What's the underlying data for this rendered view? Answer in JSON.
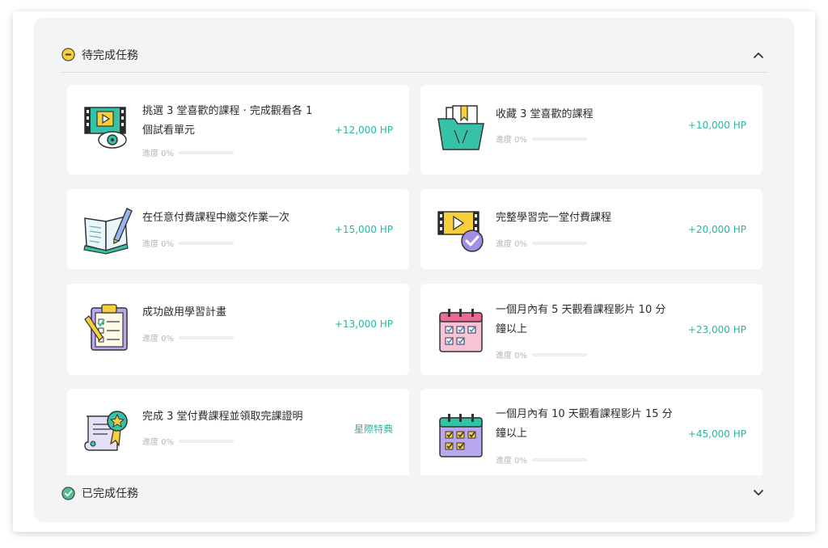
{
  "pending": {
    "title": "待完成任務",
    "tasks": [
      {
        "title": "挑選 3 堂喜歡的課程 · 完成觀看各 1 個試看單元",
        "progress_label": "進度 0%",
        "progress": 0,
        "reward": "+12,000 HP",
        "icon": "film-eye-icon"
      },
      {
        "title": "收藏 3 堂喜歡的課程",
        "progress_label": "進度 0%",
        "progress": 0,
        "reward": "+10,000 HP",
        "icon": "folder-bookmark-icon"
      },
      {
        "title": "在任意付費課程中繳交作業一次",
        "progress_label": "進度 0%",
        "progress": 0,
        "reward": "+15,000 HP",
        "icon": "notebook-pencil-icon"
      },
      {
        "title": "完整學習完一堂付費課程",
        "progress_label": "進度 0%",
        "progress": 0,
        "reward": "+20,000 HP",
        "icon": "film-check-icon"
      },
      {
        "title": "成功啟用學習計畫",
        "progress_label": "進度 0%",
        "progress": 0,
        "reward": "+13,000 HP",
        "icon": "clipboard-checklist-icon"
      },
      {
        "title": "一個月內有 5 天觀看課程影片 10 分鐘以上",
        "progress_label": "進度 0%",
        "progress": 0,
        "reward": "+23,000 HP",
        "icon": "calendar-pink-icon"
      },
      {
        "title": "完成 3 堂付費課程並領取完課證明",
        "progress_label": "進度 0%",
        "progress": 0,
        "reward": "星際特典",
        "icon": "certificate-icon"
      },
      {
        "title": "一個月內有 10 天觀看課程影片 15 分鐘以上",
        "progress_label": "進度 0%",
        "progress": 0,
        "reward": "+45,000 HP",
        "icon": "calendar-purple-icon"
      }
    ]
  },
  "completed": {
    "title": "已完成任務"
  },
  "colors": {
    "accent": "#27b89d",
    "pending_badge": "#f6cf3b",
    "completed_badge": "#4fbf8f",
    "panel_bg": "#f3f4f6"
  }
}
